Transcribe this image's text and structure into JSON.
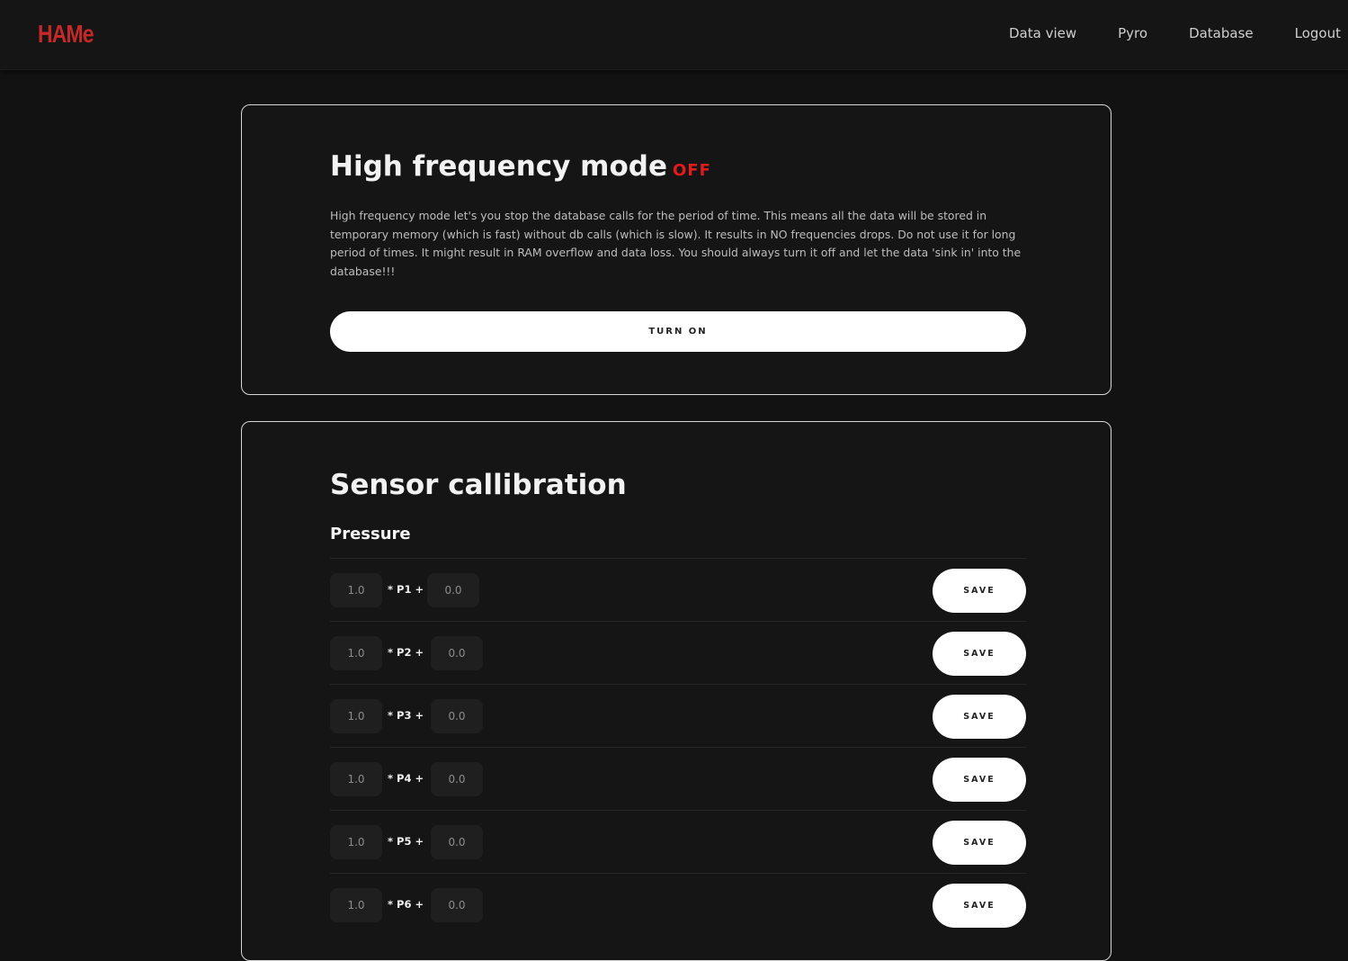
{
  "brand": {
    "logo": "HAMe",
    "color": "#c62828"
  },
  "nav": {
    "items": [
      {
        "label": "Data view"
      },
      {
        "label": "Pyro"
      },
      {
        "label": "Database"
      },
      {
        "label": "Logout"
      }
    ]
  },
  "high_frequency": {
    "title": "High frequency mode",
    "status": "OFF",
    "status_color": "#e31b1b",
    "description": "High frequency mode let's you stop the database calls for the period of time. This means all the data will be stored in temporary memory (which is fast) without db calls (which is slow). It results in NO frequencies drops. Do not use it for long period of times. It might result in RAM overflow and data loss. You should always turn it off and let the data 'sink in' into the database!!!",
    "button_label": "TURN ON"
  },
  "calibration": {
    "title": "Sensor callibration",
    "section": "Pressure",
    "save_label": "SAVE",
    "rows": [
      {
        "multiplier": "1.0",
        "label": "* P1 +",
        "offset": "0.0"
      },
      {
        "multiplier": "1.0",
        "label": "* P2 +",
        "offset": "0.0"
      },
      {
        "multiplier": "1.0",
        "label": "* P3 +",
        "offset": "0.0"
      },
      {
        "multiplier": "1.0",
        "label": "* P4 +",
        "offset": "0.0"
      },
      {
        "multiplier": "1.0",
        "label": "* P5 +",
        "offset": "0.0"
      },
      {
        "multiplier": "1.0",
        "label": "* P6 +",
        "offset": "0.0"
      }
    ]
  }
}
